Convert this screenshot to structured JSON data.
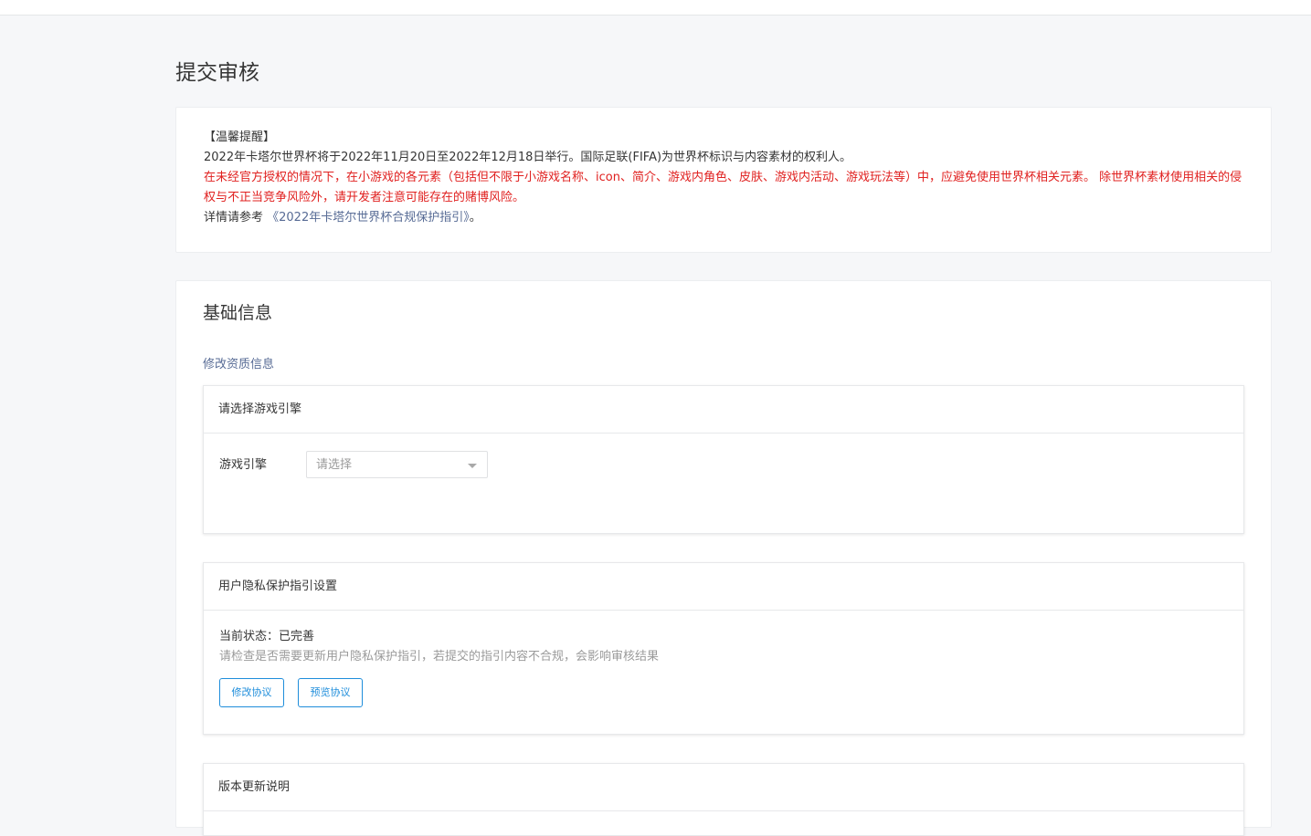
{
  "page": {
    "title": "提交审核"
  },
  "notice": {
    "heading": "【温馨提醒】",
    "line1": "2022年卡塔尔世界杯将于2022年11月20日至2022年12月18日举行。国际足联(FIFA)为世界杯标识与内容素材的权利人。",
    "warning": "在未经官方授权的情况下，在小游戏的各元素（包括但不限于小游戏名称、icon、简介、游戏内角色、皮肤、游戏内活动、游戏玩法等）中，应避免使用世界杯相关元素。 除世界杯素材使用相关的侵权与不正当竞争风险外，请开发者注意可能存在的赌博风险。",
    "ref_prefix": "详情请参考 ",
    "ref_link": "《2022年卡塔尔世界杯合规保护指引》",
    "ref_suffix": "。",
    "warning_color": "#e0201f",
    "link_color": "#576b95"
  },
  "basic_info": {
    "title": "基础信息",
    "edit_qualification_link": "修改资质信息",
    "engine_panel": {
      "header": "请选择游戏引擎",
      "field_label": "游戏引擎",
      "select_placeholder": "请选择"
    },
    "privacy_panel": {
      "header": "用户隐私保护指引设置",
      "status": "当前状态：已完善",
      "hint": "请检查是否需要更新用户隐私保护指引，若提交的指引内容不合规，会影响审核结果",
      "edit_button": "修改协议",
      "preview_button": "预览协议",
      "button_color": "#1e8ddb"
    },
    "version_panel": {
      "header": "版本更新说明"
    }
  }
}
